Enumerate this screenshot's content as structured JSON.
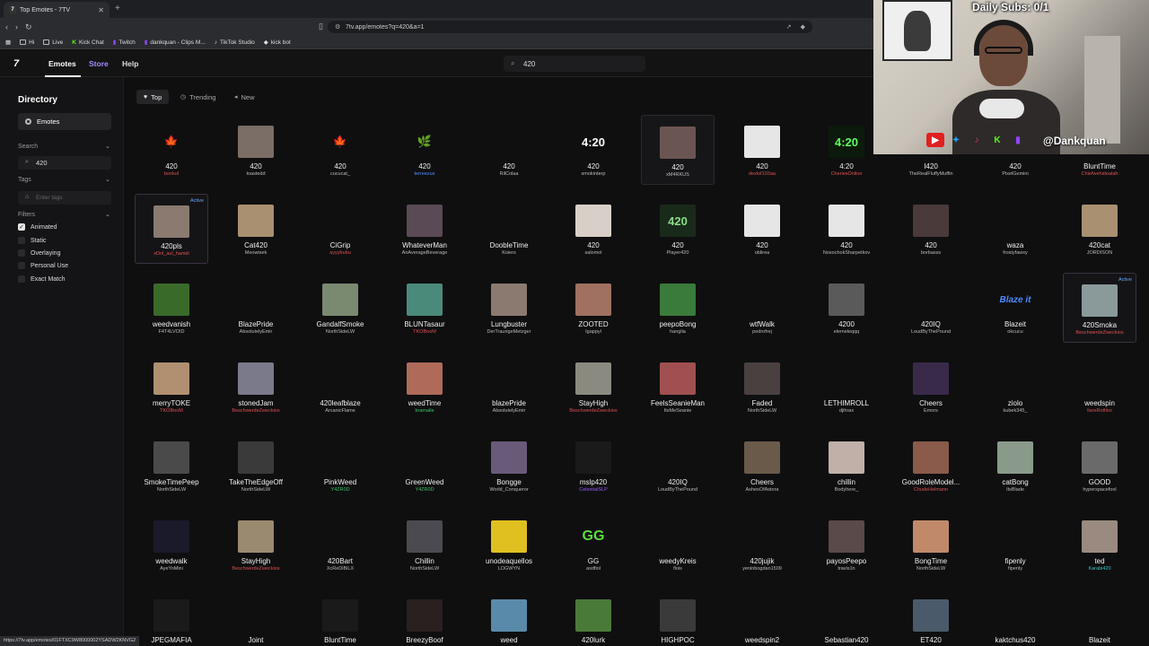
{
  "browser": {
    "tab_title": "Top Emotes - 7TV",
    "url": "7tv.app/emotes?q=420&a=1",
    "bookmarks": [
      "Hi",
      "Live",
      "Kick Chat",
      "Twitch",
      "dankquan - Clips M...",
      "TikTok Studio",
      "kick bot"
    ]
  },
  "app": {
    "logo": "7",
    "nav": {
      "emotes": "Emotes",
      "store": "Store",
      "help": "Help"
    },
    "search_value": "420"
  },
  "sidebar": {
    "title": "Directory",
    "section": "Emotes",
    "search_label": "Search",
    "search_value": "420",
    "tags_label": "Tags",
    "tags_placeholder": "Enter tags",
    "filters_label": "Filters",
    "filters": [
      {
        "label": "Animated",
        "checked": true
      },
      {
        "label": "Static",
        "checked": false
      },
      {
        "label": "Overlaying",
        "checked": false
      },
      {
        "label": "Personal Use",
        "checked": false
      },
      {
        "label": "Exact Match",
        "checked": false
      }
    ]
  },
  "sort_tabs": [
    "Top",
    "Trending",
    "New"
  ],
  "active_label": "Active",
  "emotes": [
    {
      "name": "420",
      "owner": "bonkol",
      "oc": "#e05050",
      "thumb": "🍁",
      "bg": "#0f0f10"
    },
    {
      "name": "420",
      "owner": "toastedd",
      "oc": "#bbb",
      "thumb": "",
      "bg": "#7a6e66"
    },
    {
      "name": "420",
      "owner": "cucucat_",
      "oc": "#bbb",
      "thumb": "🍁",
      "bg": "#0f0f10"
    },
    {
      "name": "420",
      "owner": "terreezus",
      "oc": "#5a8cff",
      "thumb": "🌿",
      "bg": "#0f0f10"
    },
    {
      "name": "420",
      "owner": "RilColaa",
      "oc": "#bbb",
      "thumb": "",
      "bg": "#0f0f10"
    },
    {
      "name": "420",
      "owner": "smokinterp",
      "oc": "#bbb",
      "thumb": "4:20",
      "bg": "#0f0f10"
    },
    {
      "name": "420",
      "owner": "xM4RKUS",
      "oc": "#bbb",
      "thumb": "",
      "bg": "#6b5552"
    },
    {
      "name": "420",
      "owner": "dexlof103aa",
      "oc": "#e05050",
      "thumb": "",
      "bg": "#e6e6e6"
    },
    {
      "name": "4:20",
      "owner": "CheriesOnline",
      "oc": "#e05050",
      "thumb": "4:20",
      "bg": "#0b1a0b"
    },
    {
      "name": "I420",
      "owner": "TheRealFluffyMuffin",
      "oc": "#bbb",
      "thumb": "",
      "bg": "#0f0f10"
    },
    {
      "name": "420",
      "owner": "PixelGemini",
      "oc": "#bbb",
      "thumb": "",
      "bg": "#0f0f10"
    },
    {
      "name": "BluntTime",
      "owner": "Chiefwehidealah",
      "oc": "#e05050",
      "thumb": "",
      "bg": "#0f0f10"
    },
    {
      "name": "420pls",
      "owner": "xDnl_aul_hamdi",
      "oc": "#e05050",
      "thumb": "",
      "bg": "#8a7a70"
    },
    {
      "name": "Cat420",
      "owner": "Meowisek",
      "oc": "#bbb",
      "thumb": "",
      "bg": "#a89070"
    },
    {
      "name": "CiGrip",
      "owner": "ayyybubu",
      "oc": "#e05050",
      "thumb": "",
      "bg": "#0f0f10"
    },
    {
      "name": "WhateverMan",
      "owner": "AnAverageBeverage",
      "oc": "#bbb",
      "thumb": "",
      "bg": "#5a4a55"
    },
    {
      "name": "DoobleTime",
      "owner": "Koiers",
      "oc": "#bbb",
      "thumb": "",
      "bg": "#0f0f10"
    },
    {
      "name": "420",
      "owner": "salomol",
      "oc": "#bbb",
      "thumb": "",
      "bg": "#d8d0c8"
    },
    {
      "name": "420",
      "owner": "Player420",
      "oc": "#bbb",
      "thumb": "420",
      "bg": "#1a2a1a"
    },
    {
      "name": "420",
      "owner": "oblirea",
      "oc": "#bbb",
      "thumb": "",
      "bg": "#e6e6e6"
    },
    {
      "name": "420",
      "owner": "NosochokSharpetkov",
      "oc": "#bbb",
      "thumb": "",
      "bg": "#e6e6e6"
    },
    {
      "name": "420",
      "owner": "borbasss",
      "oc": "#bbb",
      "thumb": "",
      "bg": "#4a3a3a"
    },
    {
      "name": "waza",
      "owner": "frostyfawxy",
      "oc": "#bbb",
      "thumb": "",
      "bg": "#0f0f10"
    },
    {
      "name": "420cat",
      "owner": "JORDISON",
      "oc": "#bbb",
      "thumb": "",
      "bg": "#a89070"
    },
    {
      "name": "weedvanish",
      "owner": "F4T4LVOID",
      "oc": "#bbb",
      "thumb": "",
      "bg": "#3a6a2a"
    },
    {
      "name": "BlazePride",
      "owner": "AbsolutelyEmir",
      "oc": "#bbb",
      "thumb": "",
      "bg": "#0f0f10"
    },
    {
      "name": "GandalfSmoke",
      "owner": "NorthSideLW",
      "oc": "#bbb",
      "thumb": "",
      "bg": "#7a8a70"
    },
    {
      "name": "BLUNTasaur",
      "owner": "TKOBooM",
      "oc": "#e05050",
      "thumb": "",
      "bg": "#4a8a7a"
    },
    {
      "name": "Lungbuster",
      "owner": "DerTraurigeMetzger",
      "oc": "#bbb",
      "thumb": "",
      "bg": "#8a7a70"
    },
    {
      "name": "ZOOTED",
      "owner": "Igappyl",
      "oc": "#bbb",
      "thumb": "",
      "bg": "#a07060"
    },
    {
      "name": "peepoBong",
      "owner": "hanglia",
      "oc": "#bbb",
      "thumb": "",
      "bg": "#3a7a3a"
    },
    {
      "name": "wtfWalk",
      "owner": "pedrofrej",
      "oc": "#bbb",
      "thumb": "",
      "bg": "#0f0f10"
    },
    {
      "name": "4200",
      "owner": "elemeleqqq",
      "oc": "#bbb",
      "thumb": "",
      "bg": "#5a5a5a"
    },
    {
      "name": "420IQ",
      "owner": "LoudByThePound",
      "oc": "#bbb",
      "thumb": "",
      "bg": "#0f0f10"
    },
    {
      "name": "Blazeit",
      "owner": "okcucu",
      "oc": "#bbb",
      "thumb": "Blaze it",
      "bg": "#0f0f10"
    },
    {
      "name": "420Smoka",
      "owner": "BeschwerdeZweckios",
      "oc": "#e05050",
      "thumb": "",
      "bg": "#8a9a9a"
    },
    {
      "name": "merryTOKE",
      "owner": "TKOBooM",
      "oc": "#e05050",
      "thumb": "",
      "bg": "#b09070"
    },
    {
      "name": "stonedJam",
      "owner": "BeschwerdeZweckios",
      "oc": "#e05050",
      "thumb": "",
      "bg": "#7a7a8a"
    },
    {
      "name": "420leafblaze",
      "owner": "ArcanicFlame",
      "oc": "#bbb",
      "thumb": "",
      "bg": "#0f0f10"
    },
    {
      "name": "weedTime",
      "owner": "bramaile",
      "oc": "#3fc06a",
      "thumb": "",
      "bg": "#b06a5a"
    },
    {
      "name": "blazePride",
      "owner": "AbsolutelyEmir",
      "oc": "#bbb",
      "thumb": "",
      "bg": "#0f0f10"
    },
    {
      "name": "StayHigh",
      "owner": "BeschwerdeZweckios",
      "oc": "#e05050",
      "thumb": "",
      "bg": "#8a8a80"
    },
    {
      "name": "FeelsSeanieMan",
      "owner": "ItsMeSeanie",
      "oc": "#bbb",
      "thumb": "",
      "bg": "#a05050"
    },
    {
      "name": "Faded",
      "owner": "NorthSideLW",
      "oc": "#bbb",
      "thumb": "",
      "bg": "#4a4040"
    },
    {
      "name": "LETHIMROLL",
      "owner": "djihrax",
      "oc": "#bbb",
      "thumb": "",
      "bg": "#0f0f10"
    },
    {
      "name": "Cheers",
      "owner": "Emors",
      "oc": "#bbb",
      "thumb": "",
      "bg": "#3a2a4a"
    },
    {
      "name": "ziolo",
      "owner": "kubek345_",
      "oc": "#bbb",
      "thumb": "",
      "bg": "#0f0f10"
    },
    {
      "name": "weedspin",
      "owner": "faoxRothko",
      "oc": "#e05050",
      "thumb": "",
      "bg": "#0f0f10"
    },
    {
      "name": "SmokeTimePeep",
      "owner": "NorthSideLW",
      "oc": "#bbb",
      "thumb": "",
      "bg": "#4a4a4a"
    },
    {
      "name": "TakeTheEdgeOff",
      "owner": "NorthSideLW",
      "oc": "#bbb",
      "thumb": "",
      "bg": "#3a3a3a"
    },
    {
      "name": "PinkWeed",
      "owner": "Y4ZR0D",
      "oc": "#3fc06a",
      "thumb": "",
      "bg": "#0f0f10"
    },
    {
      "name": "GreenWeed",
      "owner": "Y4ZR0D",
      "oc": "#3fc06a",
      "thumb": "",
      "bg": "#0f0f10"
    },
    {
      "name": "Bongge",
      "owner": "World_Conqueror",
      "oc": "#bbb",
      "thumb": "",
      "bg": "#6a5a7a"
    },
    {
      "name": "mslp420",
      "owner": "CelestialSLP",
      "oc": "#9a5aff",
      "thumb": "",
      "bg": "#1a1a1a"
    },
    {
      "name": "420IQ",
      "owner": "LoudByThePound",
      "oc": "#bbb",
      "thumb": "",
      "bg": "#0f0f10"
    },
    {
      "name": "Cheers",
      "owner": "AshesOfAstora",
      "oc": "#bbb",
      "thumb": "",
      "bg": "#6a5a4a"
    },
    {
      "name": "chillin",
      "owner": "Bodyhere_",
      "oc": "#bbb",
      "thumb": "",
      "bg": "#c0b0a8"
    },
    {
      "name": "GoodRoleModel...",
      "owner": "ChudeHelmann",
      "oc": "#e05050",
      "thumb": "",
      "bg": "#8a5a4a"
    },
    {
      "name": "catBong",
      "owner": "ItsBlade",
      "oc": "#bbb",
      "thumb": "",
      "bg": "#8a9a8a"
    },
    {
      "name": "GOOD",
      "owner": "hyperspacefool",
      "oc": "#bbb",
      "thumb": "",
      "bg": "#6a6a6a"
    },
    {
      "name": "weedwalk",
      "owner": "AyeYoMini",
      "oc": "#bbb",
      "thumb": "",
      "bg": "#1a1a2a"
    },
    {
      "name": "StayHigh",
      "owner": "BeschwerdeZweckios",
      "oc": "#e05050",
      "thumb": "",
      "bg": "#9a8a70"
    },
    {
      "name": "420Bart",
      "owner": "XcReDiBiLX",
      "oc": "#bbb",
      "thumb": "",
      "bg": "#0f0f10"
    },
    {
      "name": "Chillin",
      "owner": "NorthSideLW",
      "oc": "#bbb",
      "thumb": "",
      "bg": "#4a4a50"
    },
    {
      "name": "unodeaquellos",
      "owner": "LDGWYN",
      "oc": "#bbb",
      "thumb": "",
      "bg": "#e0c020"
    },
    {
      "name": "GG",
      "owner": "asdfiol",
      "oc": "#bbb",
      "thumb": "GG",
      "bg": "#0f0f10"
    },
    {
      "name": "weedyKreis",
      "owner": "flois",
      "oc": "#bbb",
      "thumb": "",
      "bg": "#0f0f10"
    },
    {
      "name": "420jujik",
      "owner": "yeninbogdan1509",
      "oc": "#bbb",
      "thumb": "",
      "bg": "#0f0f10"
    },
    {
      "name": "payosPeepo",
      "owner": "travis1n",
      "oc": "#bbb",
      "thumb": "",
      "bg": "#5a4a4a"
    },
    {
      "name": "BongTime",
      "owner": "NorthSideLW",
      "oc": "#bbb",
      "thumb": "",
      "bg": "#c08a6a"
    },
    {
      "name": "fipenly",
      "owner": "fipenly",
      "oc": "#bbb",
      "thumb": "",
      "bg": "#0f0f10"
    },
    {
      "name": "ted",
      "owner": "Karabi420",
      "oc": "#3fc0c0",
      "thumb": "",
      "bg": "#9a8a80"
    },
    {
      "name": "JPEGMAFIA",
      "owner": "",
      "oc": "#bbb",
      "thumb": "",
      "bg": "#1a1a1a"
    },
    {
      "name": "Joint",
      "owner": "",
      "oc": "#bbb",
      "thumb": "",
      "bg": "#0f0f10"
    },
    {
      "name": "BluntTime",
      "owner": "",
      "oc": "#bbb",
      "thumb": "",
      "bg": "#1a1a1a"
    },
    {
      "name": "BreezyBoof",
      "owner": "",
      "oc": "#bbb",
      "thumb": "",
      "bg": "#2a2020"
    },
    {
      "name": "weed",
      "owner": "",
      "oc": "#bbb",
      "thumb": "",
      "bg": "#5a8aaa"
    },
    {
      "name": "420lurk",
      "owner": "",
      "oc": "#bbb",
      "thumb": "",
      "bg": "#4a7a3a"
    },
    {
      "name": "HIGHPOC",
      "owner": "",
      "oc": "#bbb",
      "thumb": "",
      "bg": "#3a3a3a"
    },
    {
      "name": "weedspin2",
      "owner": "",
      "oc": "#bbb",
      "thumb": "",
      "bg": "#0f0f10"
    },
    {
      "name": "Sebastian420",
      "owner": "",
      "oc": "#bbb",
      "thumb": "",
      "bg": "#0f0f10"
    },
    {
      "name": "ET420",
      "owner": "",
      "oc": "#bbb",
      "thumb": "",
      "bg": "#4a5a6a"
    },
    {
      "name": "kaktchus420",
      "owner": "",
      "oc": "#bbb",
      "thumb": "",
      "bg": "#0f0f10"
    },
    {
      "name": "Blazeit",
      "owner": "",
      "oc": "#bbb",
      "thumb": "",
      "bg": "#0f0f10"
    }
  ],
  "overlay": {
    "subs": "Daily Subs: 0/1",
    "handle": "@Dankquan"
  },
  "status_url": "https://7tv.app/emotes/01FTXC9W8000002YSADW2KNVG2"
}
